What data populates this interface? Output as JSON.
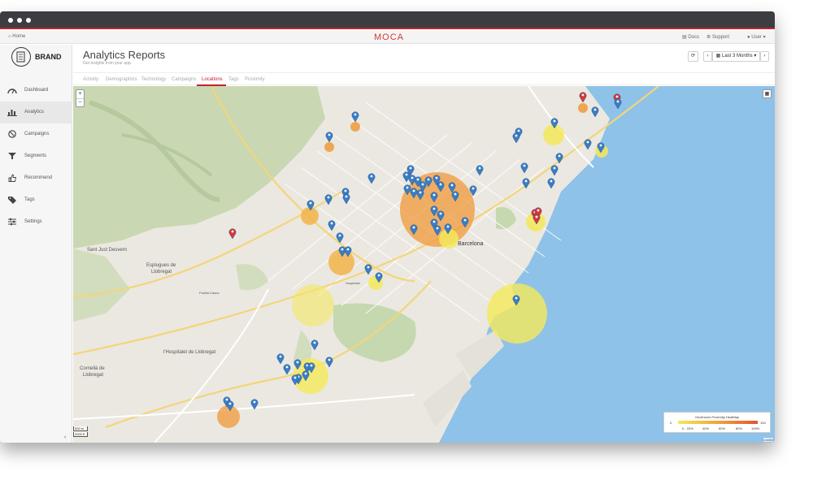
{
  "nav": {
    "home": "Home",
    "logo": "MOCA",
    "docs": "Docs",
    "support": "Support",
    "user": "User"
  },
  "brand": {
    "name": "BRAND"
  },
  "sidebar": {
    "items": [
      {
        "label": "Dashboard",
        "icon": "gauge-icon"
      },
      {
        "label": "Analytics",
        "icon": "bar-chart-icon"
      },
      {
        "label": "Campaigns",
        "icon": "megaphone-icon"
      },
      {
        "label": "Segments",
        "icon": "filter-icon"
      },
      {
        "label": "Recommend",
        "icon": "thumbs-up-icon"
      },
      {
        "label": "Tags",
        "icon": "tag-icon"
      },
      {
        "label": "Settings",
        "icon": "sliders-icon"
      }
    ],
    "active": "Analytics"
  },
  "header": {
    "title": "Analytics Reports",
    "subtitle": "Get insights from your app.",
    "date_range": "Last 3 Months"
  },
  "tabs": [
    "Activity",
    "Demographics",
    "Technology",
    "Campaigns",
    "Locations",
    "Tags",
    "Proximity"
  ],
  "active_tab": "Locations",
  "map": {
    "labels": {
      "barcelona": "Barcelona",
      "sant_just": "Sant Just Desvern",
      "esplugues_1": "Esplugues de",
      "esplugues_2": "Llobregat",
      "hospitalet": "l'Hospitalet de Llobregat",
      "cornella_1": "Cornellà de",
      "cornella_2": "Llobregat",
      "hospitalet_small": "Hospitalet",
      "pubilla": "Pubilla Cases"
    },
    "scale": {
      "metric": "500 m",
      "imperial": "2000 ft"
    },
    "attribution": "Leaflet",
    "zoom_in": "+",
    "zoom_out": "−"
  },
  "legend": {
    "title": "Geofences Proximity HeatMap",
    "min": "0",
    "max": "100",
    "ticks": [
      "0 - 20%",
      "40%",
      "60%",
      "80%",
      "100%"
    ]
  },
  "colors": {
    "accent": "#c0232b",
    "water": "#8ec2e8",
    "park": "#c9d9b3",
    "marker_blue": "#3b7dc4",
    "marker_red": "#d23a3a",
    "heat_yellow": "#f5e85a",
    "heat_orange": "#f09a3a"
  }
}
